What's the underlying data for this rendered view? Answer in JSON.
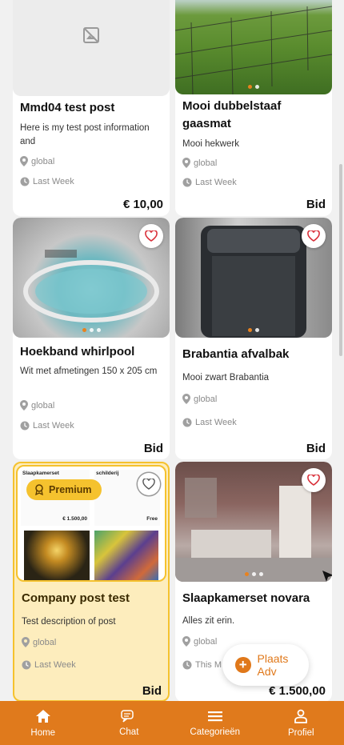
{
  "cards": [
    {
      "title": "Mmd04 test post",
      "description": "Here is my test post information and",
      "location": "global",
      "time": "Last Week",
      "price": "€ 10,00"
    },
    {
      "title": "Mooi dubbelstaaf gaasmat",
      "description": "Mooi hekwerk",
      "location": "global",
      "time": "Last Week",
      "price": "Bid"
    },
    {
      "title": "Hoekband whirlpool",
      "description": "Wit met afmetingen 150 x 205 cm",
      "location": "global",
      "time": "Last Week",
      "price": "Bid"
    },
    {
      "title": "Brabantia afvalbak",
      "description": "Mooi zwart Brabantia",
      "location": "global",
      "time": "Last Week",
      "price": "Bid"
    },
    {
      "title": "Company post test",
      "description": "Test description of post",
      "location": "global",
      "time": "Last Week",
      "price": "Bid",
      "badge": "Premium",
      "mini_left_title": "Slaapkamerset",
      "mini_left_price": "€ 1.500,00",
      "mini_right_title": "schilderij",
      "mini_right_price": "Free"
    },
    {
      "title": "Slaapkamerset novara",
      "description": "Alles zit erin.",
      "location": "global",
      "time": "This M",
      "price": "€ 1.500,00"
    }
  ],
  "fab": {
    "label": "Plaats Adv"
  },
  "nav": {
    "home": "Home",
    "chat": "Chat",
    "categories": "Categorieën",
    "profile": "Profiel"
  },
  "colors": {
    "accent": "#e07a1c",
    "premium_bg": "#fdedbd",
    "premium_badge": "#f5c22e"
  }
}
